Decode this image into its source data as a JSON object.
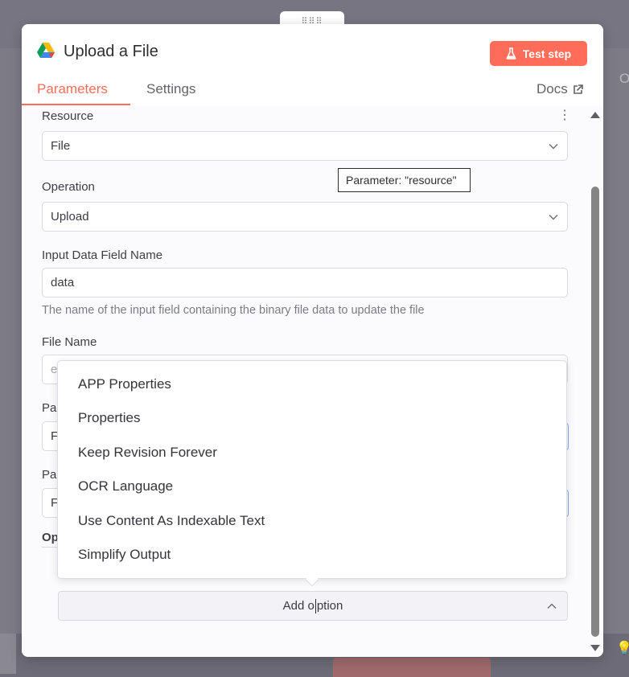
{
  "background": {
    "right_letter": "O"
  },
  "header": {
    "title": "Upload a File",
    "test_button": "Test step",
    "tabs": [
      {
        "label": "Parameters",
        "active": true
      },
      {
        "label": "Settings",
        "active": false
      }
    ],
    "docs_label": "Docs"
  },
  "fields": {
    "resource": {
      "label": "Resource",
      "value": "File"
    },
    "operation": {
      "label": "Operation",
      "value": "Upload"
    },
    "input_data_field": {
      "label": "Input Data Field Name",
      "value": "data",
      "hint": "The name of the input field containing the binary file data to update the file"
    },
    "file_name": {
      "label": "File Name",
      "placeholder_partial": "e"
    },
    "partial_1": {
      "label": "Pa",
      "value": "F"
    },
    "partial_2": {
      "label": "Pa",
      "value": "F"
    },
    "options_label": "Op"
  },
  "tooltip": {
    "text": "Parameter: \"resource\""
  },
  "dropdown": {
    "items": [
      "APP Properties",
      "Properties",
      "Keep Revision Forever",
      "OCR Language",
      "Use Content As Indexable Text",
      "Simplify Output"
    ]
  },
  "add_option": {
    "label_before": "Add ",
    "label_after": "ption",
    "label_mid": "o"
  },
  "colors": {
    "accent": "#ff6d5a",
    "focus_border": "#8aa2f3"
  }
}
